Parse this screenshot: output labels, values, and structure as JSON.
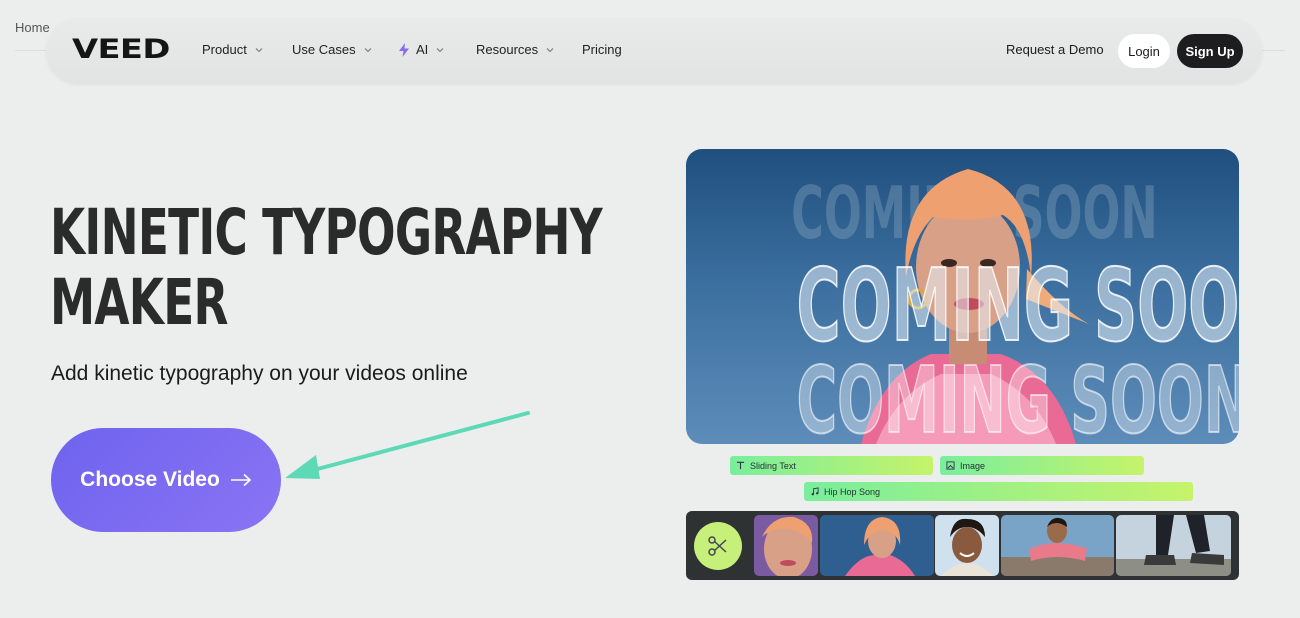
{
  "breadcrumb": {
    "home": "Home"
  },
  "nav": {
    "logo": "VEED",
    "items": [
      {
        "label": "Product",
        "has_dropdown": true
      },
      {
        "label": "Use Cases",
        "has_dropdown": true
      },
      {
        "label": "AI",
        "has_dropdown": true,
        "icon": "bolt-icon"
      },
      {
        "label": "Resources",
        "has_dropdown": true
      },
      {
        "label": "Pricing",
        "has_dropdown": false
      }
    ],
    "request_demo": "Request a Demo",
    "login": "Login",
    "signup": "Sign Up"
  },
  "hero": {
    "title_line1": "KINETIC TYPOGRAPHY",
    "title_line2": "MAKER",
    "subtitle": "Add kinetic typography on your videos online",
    "cta_label": "Choose Video",
    "cta_icon": "arrow-right-icon"
  },
  "preview": {
    "overlay_text": [
      "COMING SOON",
      "COMING SOON",
      "COMING SOON"
    ],
    "tracks": [
      {
        "label": "Sliding Text",
        "icon": "text-icon"
      },
      {
        "label": "Image",
        "icon": "image-icon"
      },
      {
        "label": "Hip Hop Song",
        "icon": "music-icon"
      }
    ],
    "filmstrip_tool": "scissors-icon"
  },
  "colors": {
    "background": "#eceeee",
    "cta_gradient": [
      "#6e63ee",
      "#8a74f4"
    ],
    "annotation_arrow": "#5dd9b5",
    "signup_bg": "#1d1d1f",
    "track_gradient": [
      "#79ee9d",
      "#c6f36a"
    ],
    "ai_bolt": "#8b6cf0"
  }
}
